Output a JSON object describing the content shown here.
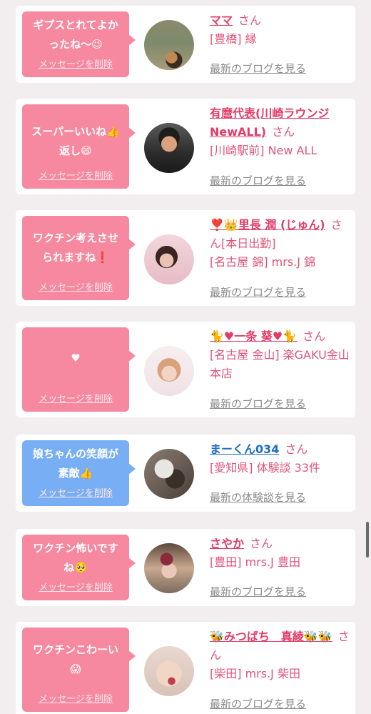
{
  "common": {
    "delete_label": "メッセージを削除",
    "san": "さん"
  },
  "items": [
    {
      "message": "ギプスとれてよかったね〜😉",
      "bubble_color": "#f6889f",
      "name": "ママ",
      "location": "[豊橋] 縁",
      "link": "最新のブログを見る",
      "avatar": "outdoor-pet-photo"
    },
    {
      "message": "スーパーいいね👍返し😄",
      "bubble_color": "#f6889f",
      "name": "有麿代表(川崎ラウンジNewALL)",
      "location": "[川崎駅前] New ALL",
      "link": "最新のブログを見る",
      "avatar": "man-portrait-photo"
    },
    {
      "message": "ワクチン考えさせられますね❗",
      "bubble_color": "#f6889f",
      "name": "❣️👑里長 潤 (じゅん)",
      "location": "[名古屋 錦] mrs.J 錦",
      "extra": "[本日出勤]",
      "link": "最新のブログを見る",
      "avatar": "woman-portrait-frame"
    },
    {
      "message": "♥",
      "bubble_color": "#f6889f",
      "name": "🐈♥一条 葵♥🐈",
      "location": "[名古屋 金山] 楽GAKU金山本店",
      "link": "最新のブログを見る",
      "avatar": "woman-bunny-ears-photo"
    },
    {
      "message": "娘ちゃんの笑顔が素敵👍",
      "bubble_color": "#78aef3",
      "name": "まーくん034",
      "location": "[愛知県] 体験談 33件",
      "link": "最新の体験談を見る",
      "avatar": "dog-photo"
    },
    {
      "message": "ワクチン怖いですね🥺",
      "bubble_color": "#f6889f",
      "name": "さやか",
      "location": "[豊田] mrs.J 豊田",
      "link": "最新のブログを見る",
      "avatar": "flowers-woman-photo"
    },
    {
      "message": "ワクチンこわーい😱",
      "bubble_color": "#f6889f",
      "name": "🐝みつばち　真綾🐝🐝",
      "location": "[柴田] mrs.J 柴田",
      "link": "最新のブログを見る",
      "avatar": "woman-closeup-photo"
    }
  ]
}
